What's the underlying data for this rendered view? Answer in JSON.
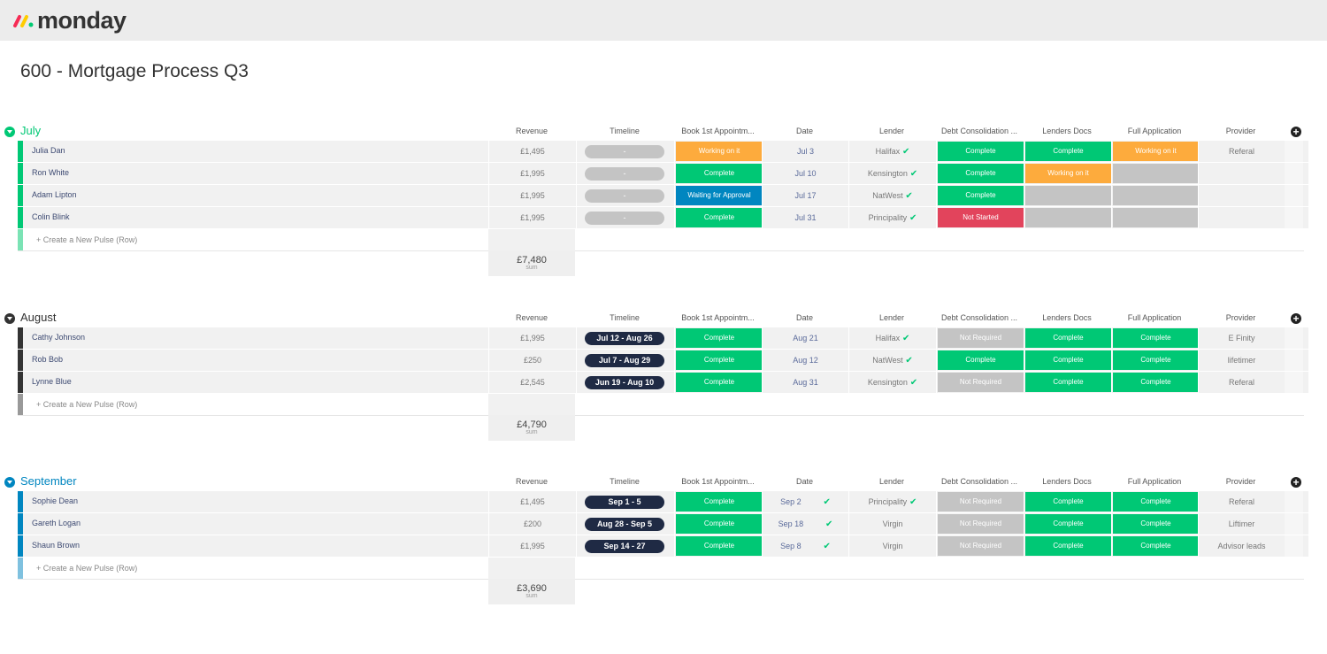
{
  "app": {
    "name": "monday"
  },
  "board": {
    "title": "600 - Mortgage Process Q3"
  },
  "colors": {
    "green": "#00c875",
    "orange": "#fdab3d",
    "blue": "#0086c0",
    "red": "#e2445c",
    "grey": "#c4c4c4",
    "navy": "#1f2a44",
    "july": "#00c875",
    "august": "#333333",
    "september": "#0086c0"
  },
  "columns": [
    "Revenue",
    "Timeline",
    "Book 1st Appointm...",
    "Date",
    "Lender",
    "Debt Consolidation ...",
    "Lenders Docs",
    "Full Application",
    "Provider"
  ],
  "groups": [
    {
      "name": "July",
      "rows": [
        {
          "name": "Julia Dan",
          "revenue": "£1,495",
          "timeline": "-",
          "book": "Working on it",
          "date": "Jul 3",
          "lender": "Halifax",
          "debt": "Complete",
          "docs": "Complete",
          "full": "Working on it",
          "provider": "Referal"
        },
        {
          "name": "Ron White",
          "revenue": "£1,995",
          "timeline": "-",
          "book": "Complete",
          "date": "Jul 10",
          "lender": "Kensington",
          "debt": "Complete",
          "docs": "Working on it",
          "full": "",
          "provider": ""
        },
        {
          "name": "Adam Lipton",
          "revenue": "£1,995",
          "timeline": "-",
          "book": "Waiting for Approval",
          "date": "Jul 17",
          "lender": "NatWest",
          "debt": "Complete",
          "docs": "",
          "full": "",
          "provider": ""
        },
        {
          "name": "Colin Blink",
          "revenue": "£1,995",
          "timeline": "-",
          "book": "Complete",
          "date": "Jul 31",
          "lender": "Principality",
          "debt": "Not Started",
          "docs": "",
          "full": "",
          "provider": ""
        }
      ],
      "new_row": "+ Create a New Pulse (Row)",
      "sum": "£7,480",
      "sum_label": "sum"
    },
    {
      "name": "August",
      "rows": [
        {
          "name": "Cathy Johnson",
          "revenue": "£1,995",
          "timeline": "Jul 12 - Aug 26",
          "book": "Complete",
          "date": "Aug 21",
          "lender": "Halifax",
          "debt": "Not Required",
          "docs": "Complete",
          "full": "Complete",
          "provider": "E Finity"
        },
        {
          "name": "Rob Bob",
          "revenue": "£250",
          "timeline": "Jul 7 - Aug 29",
          "book": "Complete",
          "date": "Aug 12",
          "lender": "NatWest",
          "debt": "Complete",
          "docs": "Complete",
          "full": "Complete",
          "provider": "lifetimer"
        },
        {
          "name": "Lynne Blue",
          "revenue": "£2,545",
          "timeline": "Jun 19 - Aug 10",
          "book": "Complete",
          "date": "Aug 31",
          "lender": "Kensington",
          "debt": "Not Required",
          "docs": "Complete",
          "full": "Complete",
          "provider": "Referal"
        }
      ],
      "new_row": "+ Create a New Pulse (Row)",
      "sum": "£4,790",
      "sum_label": "sum"
    },
    {
      "name": "September",
      "rows": [
        {
          "name": "Sophie Dean",
          "revenue": "£1,495",
          "timeline": "Sep 1 - 5",
          "book": "Complete",
          "date": "Sep 2",
          "lender": "Principality",
          "debt": "Not Required",
          "docs": "Complete",
          "full": "Complete",
          "provider": "Referal"
        },
        {
          "name": "Gareth Logan",
          "revenue": "£200",
          "timeline": "Aug 28 - Sep 5",
          "book": "Complete",
          "date": "Sep 18",
          "lender": "Virgin",
          "debt": "Not Required",
          "docs": "Complete",
          "full": "Complete",
          "provider": "Liftimer"
        },
        {
          "name": "Shaun Brown",
          "revenue": "£1,995",
          "timeline": "Sep 14 - 27",
          "book": "Complete",
          "date": "Sep 8",
          "lender": "Virgin",
          "debt": "Not Required",
          "docs": "Complete",
          "full": "Complete",
          "provider": "Advisor leads"
        }
      ],
      "new_row": "+ Create a New Pulse (Row)",
      "sum": "£3,690",
      "sum_label": "sum"
    }
  ]
}
